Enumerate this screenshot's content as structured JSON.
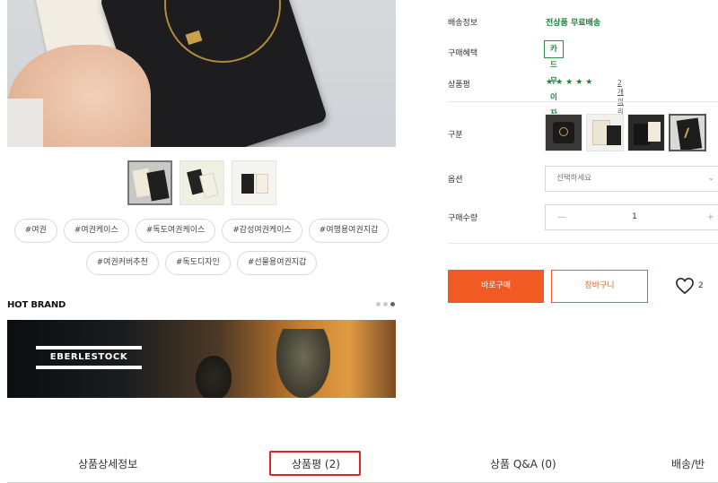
{
  "product": {
    "thumbnails": [
      "thumb-1",
      "thumb-2",
      "thumb-3"
    ],
    "hashtags": [
      "#여권",
      "#여권케이스",
      "#독도여권케이스",
      "#감성여권케이스",
      "#여행용여권지갑",
      "#여권커버추천",
      "#독도디자인",
      "#선물용여권지갑"
    ]
  },
  "hot_brand": {
    "title": "HOT BRAND",
    "banner_logo": "EBERLESTOCK"
  },
  "info": {
    "shipping_label": "배송정보",
    "shipping_value": "전상품 무료배송",
    "benefit_label": "구매혜택",
    "benefit_value": "카드무이자",
    "review_label": "상품평",
    "stars": "★★★★★",
    "review_link": "2개의 리뷰",
    "variant_label": "구분",
    "option_label": "옵션",
    "option_placeholder": "선택하세요",
    "qty_label": "구매수량",
    "qty_minus": "—",
    "qty_value": "1",
    "qty_plus": "+"
  },
  "actions": {
    "buy": "바로구매",
    "cart": "장바구니",
    "like_count": "2"
  },
  "tabs": [
    "상품상세정보",
    "상품평 (2)",
    "상품 Q&A (0)",
    "배송/반"
  ],
  "colors": {
    "accent": "#f15a22",
    "green": "#1a7f37",
    "highlight": "#e02424"
  }
}
